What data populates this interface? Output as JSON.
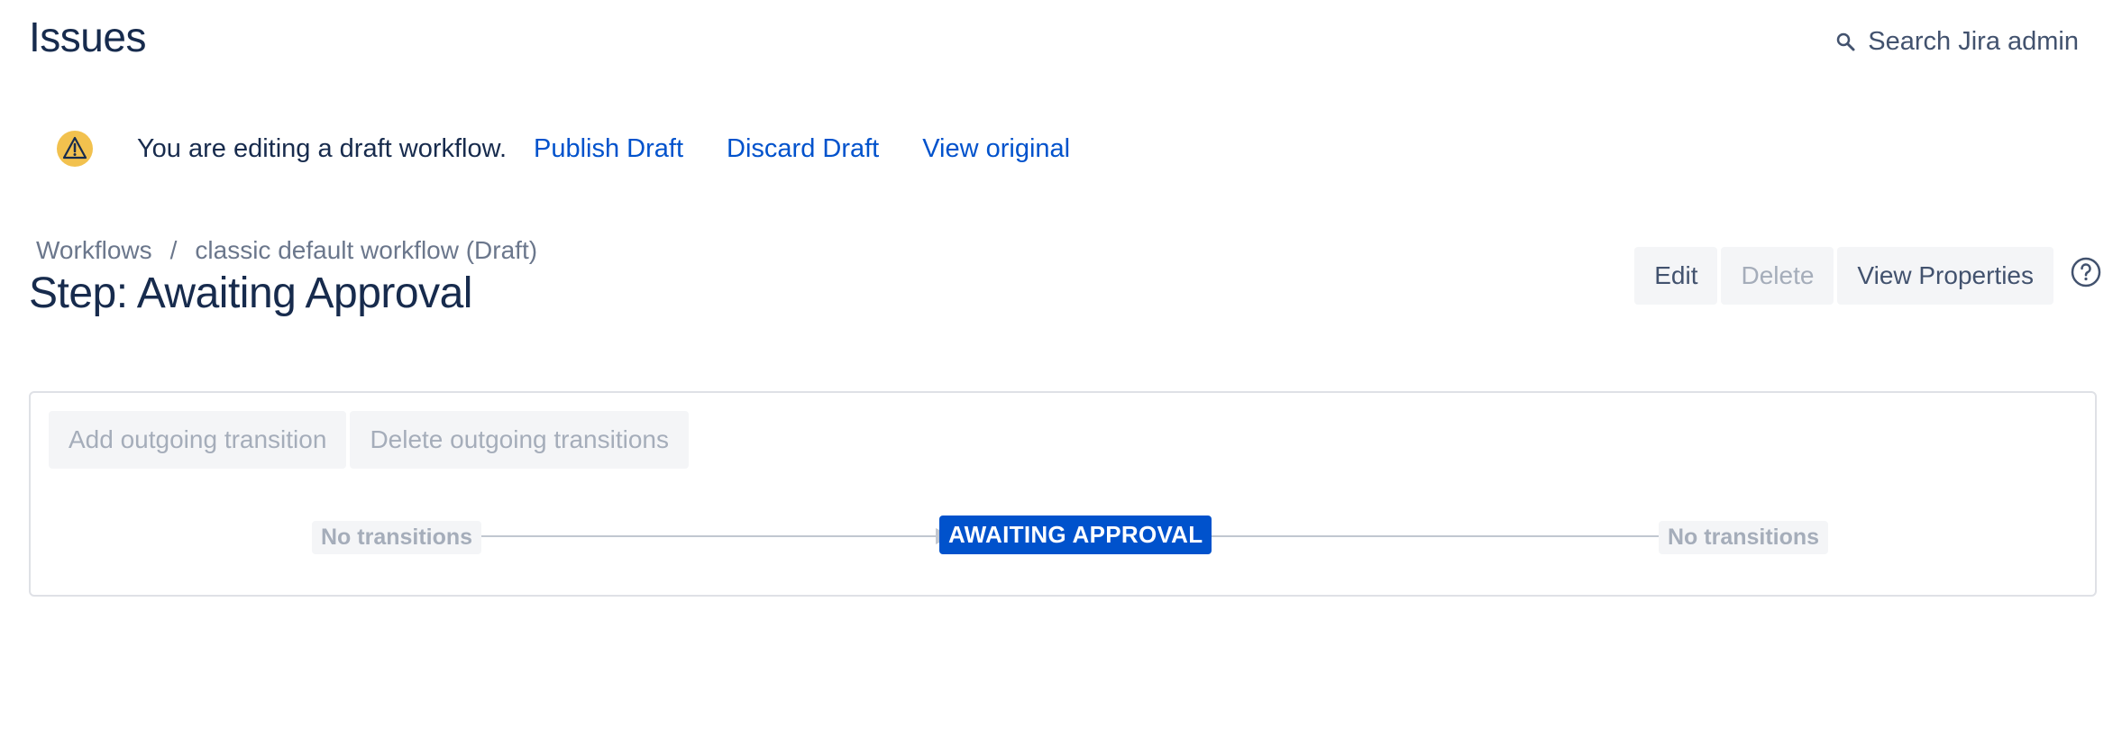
{
  "header": {
    "title": "Issues",
    "search_label": "Search Jira admin"
  },
  "banner": {
    "message": "You are editing a draft workflow.",
    "publish_label": "Publish Draft",
    "discard_label": "Discard Draft",
    "view_original_label": "View original"
  },
  "breadcrumb": {
    "items": [
      "Workflows",
      "classic default workflow (Draft)"
    ],
    "separator": "/"
  },
  "step_title": "Step: Awaiting Approval",
  "actions": {
    "edit_label": "Edit",
    "delete_label": "Delete",
    "view_properties_label": "View Properties"
  },
  "panel": {
    "add_transition_label": "Add outgoing transition",
    "delete_transitions_label": "Delete outgoing transitions",
    "incoming_label": "No transitions",
    "status_label": "AWAITING APPROVAL",
    "outgoing_label": "No transitions"
  },
  "colors": {
    "link": "#0052cc",
    "status_blue": "#0052cc",
    "warning": "#ffc400"
  },
  "icons": {
    "search": "search-icon",
    "warning": "warning-icon",
    "help": "help-icon"
  }
}
